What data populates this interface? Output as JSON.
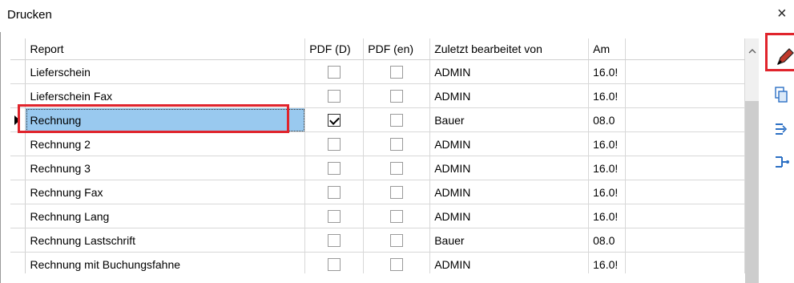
{
  "window": {
    "title": "Drucken",
    "close_glyph": "×"
  },
  "grid": {
    "columns": [
      "Report",
      "PDF (D)",
      "PDF (en)",
      "Zuletzt bearbeitet von",
      "Am"
    ],
    "rows": [
      {
        "report": "Lieferschein",
        "pdf_d": false,
        "pdf_en": false,
        "user": "ADMIN",
        "date": "16.0!"
      },
      {
        "report": "Lieferschein Fax",
        "pdf_d": false,
        "pdf_en": false,
        "user": "ADMIN",
        "date": "16.0!"
      },
      {
        "report": "Rechnung",
        "pdf_d": true,
        "pdf_en": false,
        "user": "Bauer",
        "date": "08.0"
      },
      {
        "report": "Rechnung 2",
        "pdf_d": false,
        "pdf_en": false,
        "user": "ADMIN",
        "date": "16.0!"
      },
      {
        "report": "Rechnung 3",
        "pdf_d": false,
        "pdf_en": false,
        "user": "ADMIN",
        "date": "16.0!"
      },
      {
        "report": "Rechnung Fax",
        "pdf_d": false,
        "pdf_en": false,
        "user": "ADMIN",
        "date": "16.0!"
      },
      {
        "report": "Rechnung Lang",
        "pdf_d": false,
        "pdf_en": false,
        "user": "ADMIN",
        "date": "16.0!"
      },
      {
        "report": "Rechnung Lastschrift",
        "pdf_d": false,
        "pdf_en": false,
        "user": "Bauer",
        "date": "08.0"
      },
      {
        "report": "Rechnung mit Buchungsfahne",
        "pdf_d": false,
        "pdf_en": false,
        "user": "ADMIN",
        "date": "16.0!"
      }
    ],
    "selected_row": 2
  },
  "sidebar": {
    "tools": [
      {
        "icon": "pencil-edit-icon",
        "highlighted": true
      },
      {
        "icon": "copy-icon"
      },
      {
        "icon": "indent-icon"
      },
      {
        "icon": "tree-structure-icon"
      }
    ]
  },
  "colors": {
    "selection": "#99c9ef",
    "highlight_box": "#e0242c",
    "icon": "#2b6fc4"
  }
}
